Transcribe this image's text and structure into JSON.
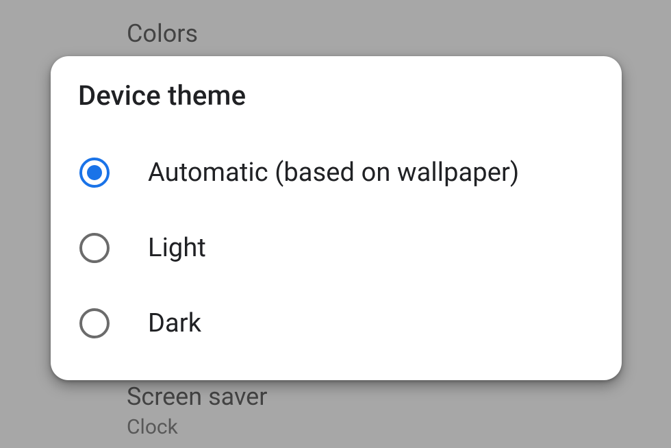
{
  "background": {
    "item_above": "Colors",
    "item_below_title": "Screen saver",
    "item_below_subtitle": "Clock"
  },
  "dialog": {
    "title": "Device theme",
    "options": [
      {
        "label": "Automatic (based on wallpaper)",
        "selected": true
      },
      {
        "label": "Light",
        "selected": false
      },
      {
        "label": "Dark",
        "selected": false
      }
    ]
  }
}
